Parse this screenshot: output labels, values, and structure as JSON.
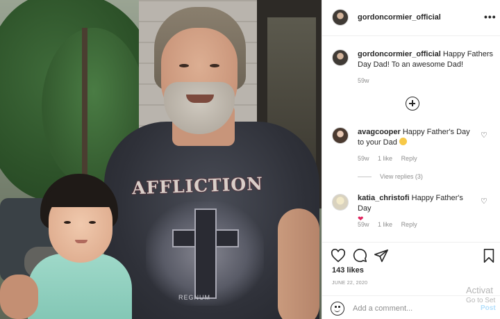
{
  "post": {
    "username": "gordoncormier_official",
    "more_label": "•••",
    "caption": {
      "username": "gordoncormier_official",
      "text": "Happy Fathers Day Dad! To an awesome Dad!",
      "age": "59w"
    },
    "shirt_brand": "AFFLICTION",
    "shirt_motto": "REGNUM",
    "comments": [
      {
        "username": "avagcooper",
        "text": "Happy Father's Day to your Dad",
        "emoji": "smile-emoji",
        "age": "59w",
        "likes": "1 like",
        "reply_label": "Reply",
        "view_replies": "View replies (3)"
      },
      {
        "username": "katia_christofi",
        "text": "Happy Father's Day",
        "emoji": "heart-emoji",
        "age": "59w",
        "likes": "1 like",
        "reply_label": "Reply"
      }
    ],
    "likes_count": "143 likes",
    "date": "JUNE 22, 2020",
    "add_comment": {
      "placeholder": "Add a comment...",
      "post_label": "Post"
    }
  },
  "watermark": {
    "line1": "Activat",
    "line2": "Go to Set"
  },
  "colors": {
    "text": "#262626",
    "muted": "#8e8e8e",
    "border": "#efefef",
    "post_button": "#b2dffc",
    "heart_emoji": "#e0245e"
  }
}
